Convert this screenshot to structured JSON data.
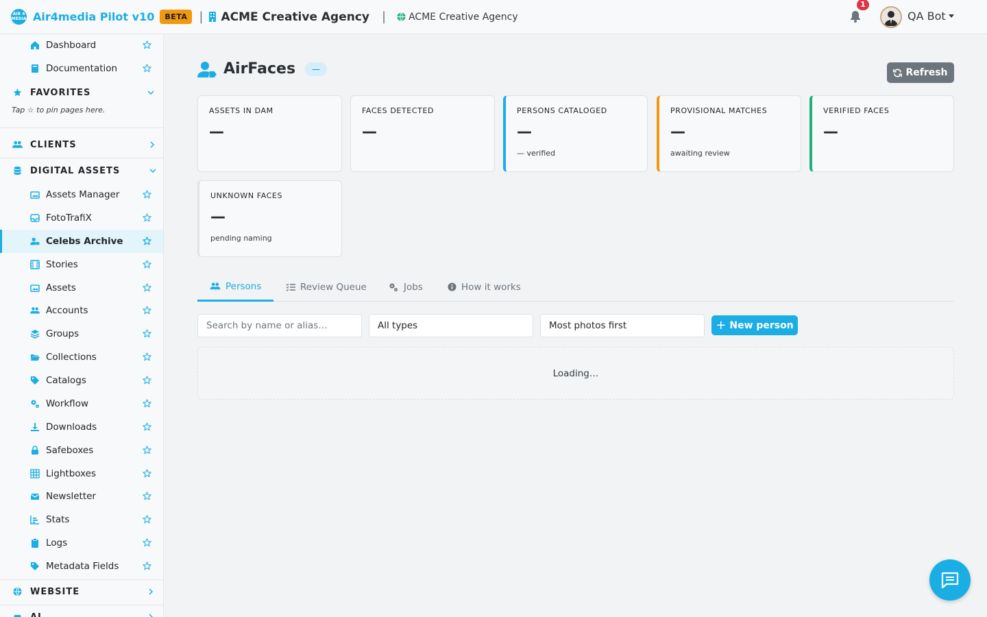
{
  "colors": {
    "accent": "#1aaee5",
    "beta": "#f0980e",
    "badge": "#dc3545",
    "success": "#20b07a",
    "secondary": "#6c757d"
  },
  "header": {
    "logo_text": "AIR 4 MEDIA",
    "app_name": "Air4media Pilot v10",
    "beta": "BETA",
    "org_name": "ACME Creative Agency",
    "site_name": "ACME Creative Agency",
    "notification_count": "1",
    "user_name": "QA Bot"
  },
  "sidebar": {
    "top_items": [
      {
        "label": "Dashboard",
        "icon": "home-icon"
      },
      {
        "label": "Documentation",
        "icon": "book-icon"
      }
    ],
    "favorites": {
      "label": "FAVORITES",
      "hint": "Tap ☆ to pin pages here."
    },
    "clients": {
      "label": "CLIENTS"
    },
    "digital_assets": {
      "label": "DIGITAL ASSETS",
      "items": [
        {
          "label": "Assets Manager",
          "icon": "images-icon"
        },
        {
          "label": "FotoTrafiX",
          "icon": "inbox-icon"
        },
        {
          "label": "Celebs Archive",
          "icon": "user-tag-icon",
          "active": true
        },
        {
          "label": "Stories",
          "icon": "film-icon"
        },
        {
          "label": "Assets",
          "icon": "images-icon"
        },
        {
          "label": "Accounts",
          "icon": "users-icon"
        },
        {
          "label": "Groups",
          "icon": "layer-group-icon"
        },
        {
          "label": "Collections",
          "icon": "folder-open-icon"
        },
        {
          "label": "Catalogs",
          "icon": "tags-icon"
        },
        {
          "label": "Workflow",
          "icon": "cogs-icon"
        },
        {
          "label": "Downloads",
          "icon": "download-icon"
        },
        {
          "label": "Safeboxes",
          "icon": "lock-icon"
        },
        {
          "label": "Lightboxes",
          "icon": "th-icon"
        },
        {
          "label": "Newsletter",
          "icon": "envelope-icon"
        },
        {
          "label": "Stats",
          "icon": "chart-icon"
        },
        {
          "label": "Logs",
          "icon": "clipboard-icon"
        },
        {
          "label": "Metadata Fields",
          "icon": "tags-icon"
        }
      ]
    },
    "website": {
      "label": "WEBSITE"
    },
    "ai": {
      "label": "AI"
    }
  },
  "main": {
    "title": "AirFaces",
    "title_pill": "—",
    "refresh_label": "Refresh",
    "cards": [
      {
        "label": "ASSETS IN DAM",
        "value": "—",
        "sub": ""
      },
      {
        "label": "FACES DETECTED",
        "value": "—",
        "sub": ""
      },
      {
        "label": "PERSONS CATALOGED",
        "value": "—",
        "sub": "— verified"
      },
      {
        "label": "PROVISIONAL MATCHES",
        "value": "—",
        "sub": "awaiting review"
      },
      {
        "label": "VERIFIED FACES",
        "value": "—",
        "sub": ""
      },
      {
        "label": "UNKNOWN FACES",
        "value": "—",
        "sub": "pending naming"
      }
    ],
    "tabs": [
      {
        "label": "Persons",
        "icon": "users-icon",
        "active": true
      },
      {
        "label": "Review Queue",
        "icon": "tasks-icon"
      },
      {
        "label": "Jobs",
        "icon": "cogs-icon"
      },
      {
        "label": "How it works",
        "icon": "info-circle-icon"
      }
    ],
    "search": {
      "placeholder": "Search by name or alias…",
      "value": ""
    },
    "type_filter": {
      "value": "All types"
    },
    "sort": {
      "value": "Most photos first"
    },
    "new_person_label": "New person",
    "loading_text": "Loading…"
  }
}
